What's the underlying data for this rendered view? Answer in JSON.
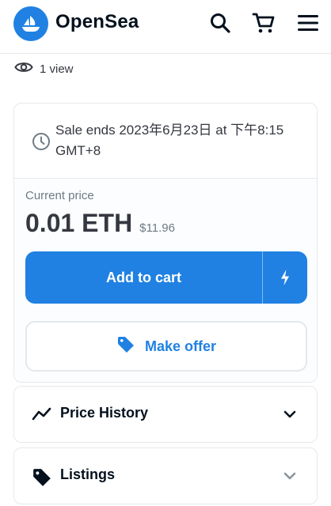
{
  "header": {
    "brand": "OpenSea",
    "icons": {
      "logo": "opensea-logo-icon",
      "search": "search-icon",
      "cart": "cart-icon",
      "menu": "menu-icon"
    }
  },
  "views": {
    "text": "1 view",
    "icon": "eye-icon"
  },
  "sale": {
    "ends_text": "Sale ends 2023年6月23日 at 下午8:15 GMT+8",
    "icon": "clock-icon"
  },
  "price": {
    "label": "Current price",
    "eth": "0.01 ETH",
    "usd": "$11.96"
  },
  "buttons": {
    "add_to_cart": "Add to cart",
    "buy_now_icon": "lightning-icon",
    "make_offer": "Make offer",
    "make_offer_icon": "tag-icon"
  },
  "panels": [
    {
      "title": "Price History",
      "icon": "trend-line-icon",
      "chevron": "chevron-down-icon"
    },
    {
      "title": "Listings",
      "icon": "tag-icon",
      "chevron": "chevron-down-icon"
    }
  ],
  "colors": {
    "accent": "#2081e2",
    "text": "#04111d",
    "muted": "#707a83",
    "border": "#e5e8eb"
  }
}
